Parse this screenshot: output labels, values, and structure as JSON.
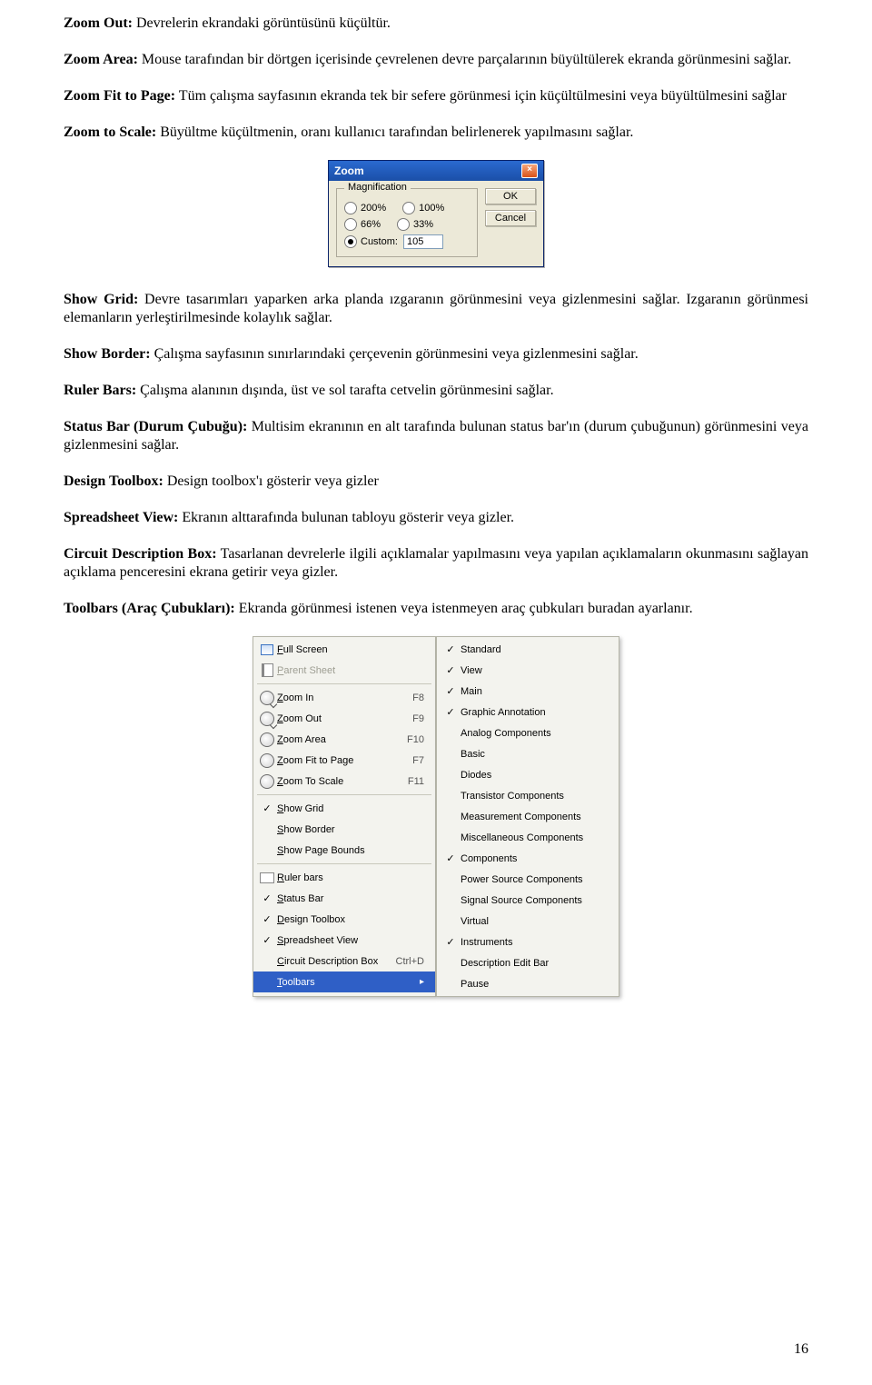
{
  "paragraphs": {
    "p1_term": "Zoom Out:",
    "p1_text": " Devrelerin ekrandaki görüntüsünü küçültür.",
    "p2_term": "Zoom Area:",
    "p2_text": " Mouse tarafından bir dörtgen içerisinde çevrelenen devre parçalarının büyültülerek ekranda görünmesini sağlar.",
    "p3_term": "Zoom Fit to Page:",
    "p3_text": " Tüm çalışma sayfasının ekranda tek bir sefere görünmesi için küçültülmesini veya büyültülmesini sağlar",
    "p4_term": "Zoom to Scale:",
    "p4_text": " Büyültme küçültmenin, oranı kullanıcı tarafından belirlenerek yapılmasını sağlar.",
    "p5_term": "Show Grid:",
    "p5_text": " Devre tasarımları yaparken arka planda ızgaranın görünmesini veya gizlenmesini sağlar. Izgaranın görünmesi  elemanların yerleştirilmesinde kolaylık sağlar.",
    "p6_term": "Show Border:",
    "p6_text": " Çalışma sayfasının sınırlarındaki çerçevenin görünmesini veya gizlenmesini sağlar.",
    "p7_term": "Ruler Bars:",
    "p7_text": " Çalışma alanının dışında, üst ve sol tarafta cetvelin görünmesini sağlar.",
    "p8_term": "Status Bar (Durum Çubuğu):",
    "p8_text": " Multisim ekranının en alt tarafında bulunan status bar'ın (durum çubuğunun) görünmesini veya gizlenmesini sağlar.",
    "p9_term": "Design Toolbox:",
    "p9_text": " Design toolbox'ı gösterir veya gizler",
    "p10_term": "Spreadsheet View:",
    "p10_text": " Ekranın alttarafında bulunan tabloyu gösterir veya gizler.",
    "p11_term": "Circuit Description Box:",
    "p11_text": " Tasarlanan devrelerle ilgili açıklamalar yapılmasını veya yapılan açıklamaların okunmasını sağlayan açıklama penceresini ekrana getirir veya gizler.",
    "p12_term": "Toolbars (Araç Çubukları):",
    "p12_text": " Ekranda görünmesi istenen veya istenmeyen araç çubkuları buradan ayarlanır."
  },
  "zoom_dialog": {
    "title": "Zoom",
    "close_glyph": "×",
    "legend": "Magnification",
    "r1a": "200%",
    "r1b": "100%",
    "r2a": "66%",
    "r2b": "33%",
    "custom_label": "Custom:",
    "custom_value": "105",
    "ok": "OK",
    "cancel": "Cancel"
  },
  "menu_left": [
    {
      "icon": "fullscreen",
      "label": "Full Screen",
      "shortcut": "",
      "sub": false,
      "checked": false,
      "disabled": false
    },
    {
      "icon": "sheet",
      "label": "Parent Sheet",
      "shortcut": "",
      "sub": false,
      "checked": false,
      "disabled": true
    },
    {
      "sep": true
    },
    {
      "icon": "zin",
      "label": "Zoom In",
      "shortcut": "F8",
      "sub": false,
      "checked": false,
      "disabled": false
    },
    {
      "icon": "zout",
      "label": "Zoom Out",
      "shortcut": "F9",
      "sub": false,
      "checked": false,
      "disabled": false
    },
    {
      "icon": "zarea",
      "label": "Zoom Area",
      "shortcut": "F10",
      "sub": false,
      "checked": false,
      "disabled": false
    },
    {
      "icon": "zfit",
      "label": "Zoom Fit to Page",
      "shortcut": "F7",
      "sub": false,
      "checked": false,
      "disabled": false
    },
    {
      "icon": "zscale",
      "label": "Zoom To Scale",
      "shortcut": "F11",
      "sub": false,
      "checked": false,
      "disabled": false
    },
    {
      "sep": true
    },
    {
      "icon": "",
      "label": "Show Grid",
      "shortcut": "",
      "sub": false,
      "checked": true,
      "disabled": false
    },
    {
      "icon": "",
      "label": "Show Border",
      "shortcut": "",
      "sub": false,
      "checked": false,
      "disabled": false
    },
    {
      "icon": "",
      "label": "Show Page Bounds",
      "shortcut": "",
      "sub": false,
      "checked": false,
      "disabled": false
    },
    {
      "sep": true
    },
    {
      "icon": "ruler",
      "label": "Ruler bars",
      "shortcut": "",
      "sub": false,
      "checked": false,
      "disabled": false
    },
    {
      "icon": "tb",
      "label": "Status Bar",
      "shortcut": "",
      "sub": false,
      "checked": true,
      "disabled": false
    },
    {
      "icon": "sel",
      "label": "Design Toolbox",
      "shortcut": "",
      "sub": false,
      "checked": true,
      "disabled": false
    },
    {
      "icon": "sel",
      "label": "Spreadsheet View",
      "shortcut": "",
      "sub": false,
      "checked": true,
      "disabled": false
    },
    {
      "icon": "",
      "label": "Circuit Description Box",
      "shortcut": "Ctrl+D",
      "sub": false,
      "checked": false,
      "disabled": false
    },
    {
      "icon": "",
      "label": "Toolbars",
      "shortcut": "",
      "sub": true,
      "checked": false,
      "disabled": false,
      "highlight": true
    }
  ],
  "menu_right": [
    {
      "label": "Standard",
      "checked": true
    },
    {
      "label": "View",
      "checked": true
    },
    {
      "label": "Main",
      "checked": true
    },
    {
      "label": "Graphic Annotation",
      "checked": true
    },
    {
      "label": "Analog Components",
      "checked": false
    },
    {
      "label": "Basic",
      "checked": false
    },
    {
      "label": "Diodes",
      "checked": false
    },
    {
      "label": "Transistor Components",
      "checked": false
    },
    {
      "label": "Measurement Components",
      "checked": false
    },
    {
      "label": "Miscellaneous Components",
      "checked": false
    },
    {
      "label": "Components",
      "checked": true
    },
    {
      "label": "Power Source Components",
      "checked": false
    },
    {
      "label": "Signal Source Components",
      "checked": false
    },
    {
      "label": "Virtual",
      "checked": false
    },
    {
      "label": "Instruments",
      "checked": true
    },
    {
      "label": "Description Edit Bar",
      "checked": false
    },
    {
      "label": "Pause",
      "checked": false
    }
  ],
  "page_number": "16"
}
